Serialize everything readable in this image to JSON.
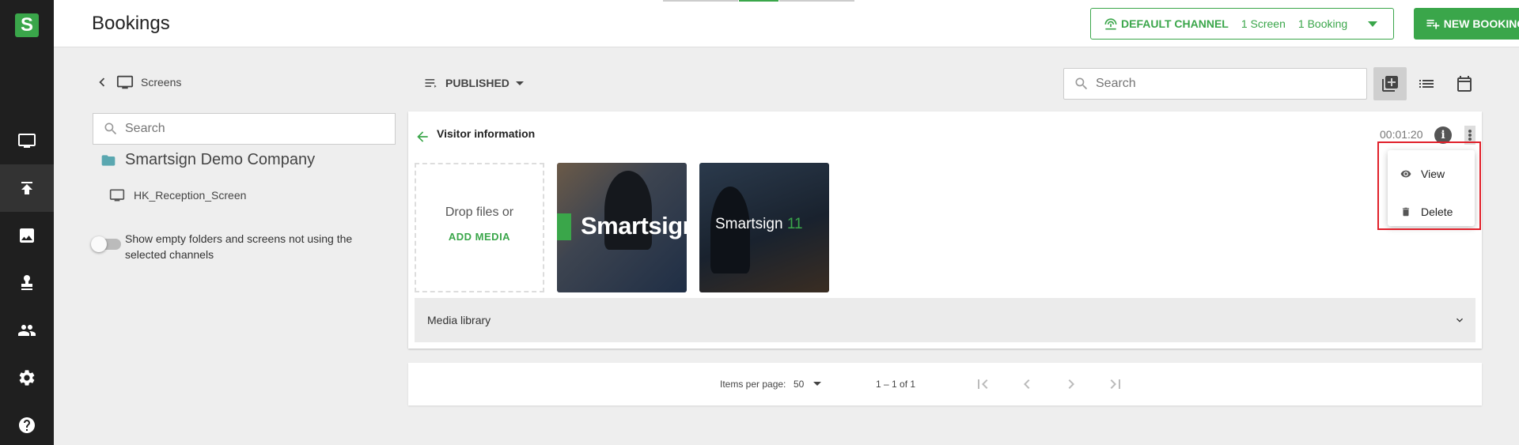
{
  "app": {
    "logo_letter": "S"
  },
  "sidebar": {
    "items": [
      {
        "name": "screens",
        "icon": "monitor-icon"
      },
      {
        "name": "publish",
        "icon": "publish-icon",
        "active": true
      },
      {
        "name": "media",
        "icon": "image-icon"
      },
      {
        "name": "stamp",
        "icon": "stamp-icon"
      },
      {
        "name": "users",
        "icon": "users-icon"
      },
      {
        "name": "settings",
        "icon": "gear-icon"
      },
      {
        "name": "help",
        "icon": "help-icon"
      }
    ]
  },
  "header": {
    "title": "Bookings",
    "channel": {
      "name": "DEFAULT CHANNEL",
      "screens": "1 Screen",
      "bookings": "1 Booking"
    },
    "new_booking_label": "NEW BOOKING"
  },
  "left_panel": {
    "breadcrumb_label": "Screens",
    "search_placeholder": "Search",
    "folder_name": "Smartsign Demo Company",
    "screen_name": "HK_Reception_Screen",
    "toggle_label": "Show empty folders and screens not using the selected channels"
  },
  "toolbar": {
    "filter_label": "PUBLISHED",
    "search_placeholder": "Search"
  },
  "booking": {
    "title": "Visitor information",
    "duration": "00:01:20",
    "dropzone_text": "Drop files or",
    "add_media_label": "ADD MEDIA",
    "thumbs": [
      {
        "brand": "Smartsign"
      },
      {
        "brand": "Smartsign",
        "number": "11"
      }
    ],
    "media_library_label": "Media library"
  },
  "context_menu": {
    "view_label": "View",
    "delete_label": "Delete"
  },
  "pagination": {
    "items_per_page_label": "Items per page:",
    "items_per_page_value": "50",
    "range": "1 – 1 of 1"
  },
  "colors": {
    "accent": "#3aa64a",
    "rail": "#1f1f1f",
    "highlight": "#e0202a"
  }
}
